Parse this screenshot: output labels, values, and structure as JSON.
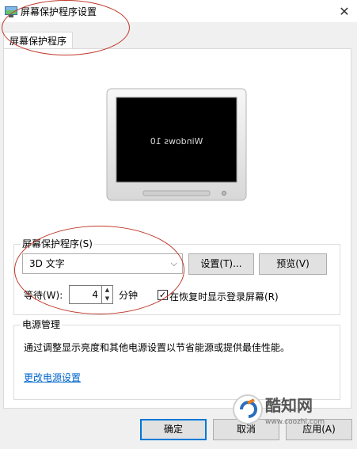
{
  "window": {
    "title": "屏幕保护程序设置",
    "close_glyph": "✕"
  },
  "tab": {
    "label": "屏幕保护程序"
  },
  "preview_screen": {
    "text": "Windows 10"
  },
  "screensaver": {
    "group_label": "屏幕保护程序(S)",
    "selected": "3D 文字",
    "settings_button": "设置(T)...",
    "preview_button": "预览(V)",
    "wait_label": "等待(W):",
    "wait_value": "4",
    "wait_unit": "分钟",
    "resume_checkbox_label": "在恢复时显示登录屏幕(R)",
    "resume_checked": true
  },
  "power": {
    "group_label": "电源管理",
    "description": "通过调整显示亮度和其他电源设置以节省能源或提供最佳性能。",
    "link": "更改电源设置"
  },
  "footer": {
    "ok_button": "确定",
    "cancel_button": "取消",
    "apply_button": "应用(A)"
  },
  "watermark": {
    "brand": "酷知网",
    "url": "www.coozhi.com"
  },
  "colors": {
    "accent": "#0078d7",
    "annotation": "#c0392b",
    "link": "#0066cc"
  }
}
